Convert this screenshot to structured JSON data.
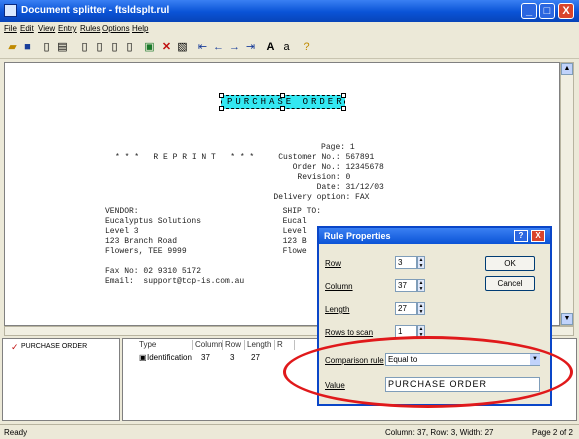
{
  "window": {
    "title": "Document splitter - ftsldsplt.rul",
    "minimize": "_",
    "maximize": "□",
    "close": "X"
  },
  "menu": [
    "File",
    "Edit",
    "View",
    "Entry",
    "Rules",
    "Options",
    "Help"
  ],
  "document": {
    "highlight_text": "PURCHASE ORDER",
    "lines": [
      "                                             Page: 1",
      "     * * *   R E P R I N T   * * *     Customer No.: 567891",
      "                                          Order No.: 12345678",
      "                                           Revision: 0",
      "                                               Date: 31/12/03",
      "                                      Delivery option: FAX",
      "VENDOR:                              SHIP TO:",
      "Eucalyptus Solutions                 Eucal",
      "Level 3                              Level",
      "123 Branch Road                      123 B",
      "Flowers, TEE 9999                    Flowe",
      "",
      "Fax No: 02 9310 5172",
      "Email:  support@tcp-is.com.au"
    ]
  },
  "rule_tree": {
    "item": "PURCHASE ORDER"
  },
  "rule_list": {
    "columns": [
      "Type",
      "Column",
      "Row",
      "Length",
      "R"
    ],
    "row": {
      "type": "Identification",
      "column": "37",
      "row": "3",
      "length": "27"
    }
  },
  "dialog": {
    "title": "Rule Properties",
    "help": "?",
    "close": "X",
    "fields": {
      "row_label": "Row",
      "row_value": "3",
      "column_label": "Column",
      "column_value": "37",
      "length_label": "Length",
      "length_value": "27",
      "rows_to_scan_label": "Rows to scan",
      "rows_to_scan_value": "1"
    },
    "comparison_label": "Comparison rule",
    "comparison_value": "Equal to",
    "value_label": "Value",
    "value_value": "PURCHASE ORDER",
    "ok": "OK",
    "cancel": "Cancel"
  },
  "status": {
    "left": "Ready",
    "position": "Column: 37, Row: 3, Width: 27",
    "page": "Page 2 of 2"
  },
  "colors": {
    "accent": "#0a53d6",
    "highlight": "#33e8f2",
    "annotation": "#e0191b"
  }
}
